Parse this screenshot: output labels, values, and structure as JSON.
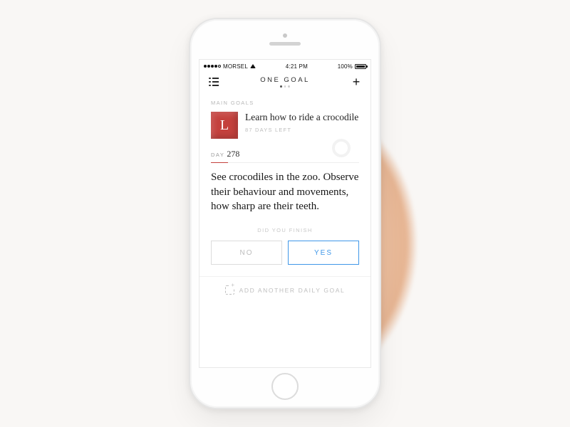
{
  "status": {
    "carrier": "MORSEL",
    "time": "4:21 PM",
    "battery_pct": "100%"
  },
  "nav": {
    "title": "ONE GOAL"
  },
  "section_label": "MAIN GOALS",
  "goal": {
    "tile_letter": "L",
    "title": "Learn how to ride a crocodile",
    "subtitle": "87 DAYS LEFT"
  },
  "day": {
    "label": "DAY",
    "number": "278"
  },
  "body": "See crocodiles in the zoo. Observe their behaviour and movements, how sharp are their teeth.",
  "prompt": "DID YOU FINISH",
  "buttons": {
    "no": "NO",
    "yes": "YES"
  },
  "add_label": "ADD ANOTHER DAILY GOAL"
}
